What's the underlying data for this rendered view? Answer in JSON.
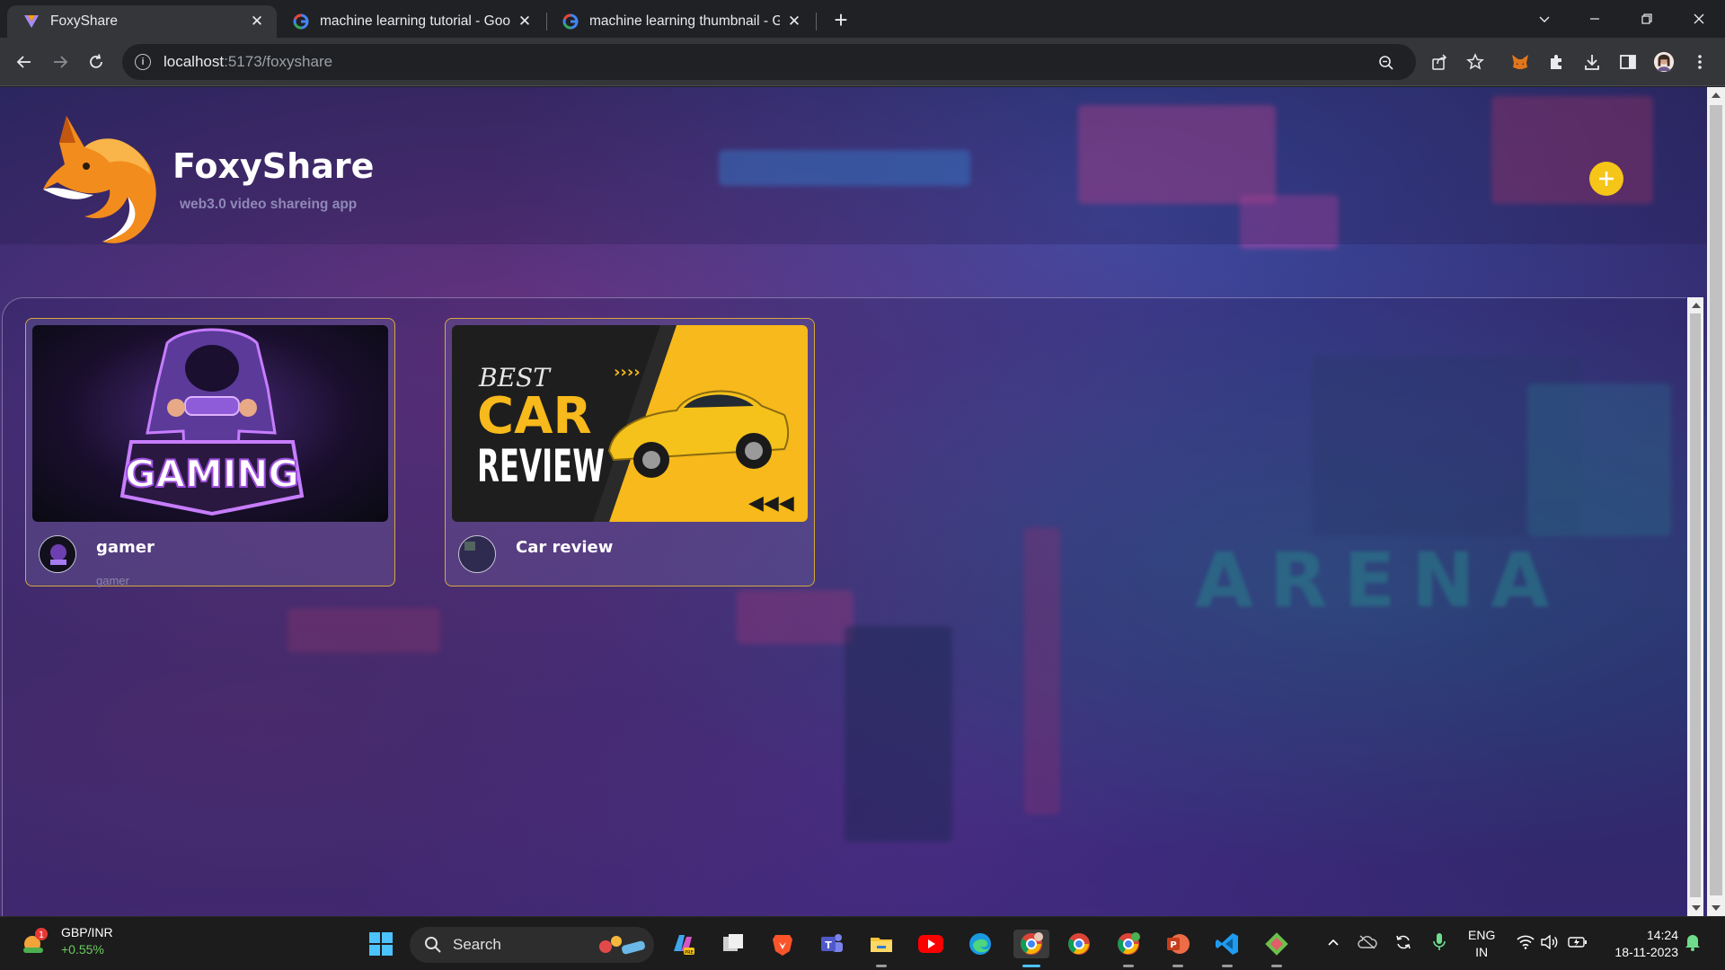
{
  "browser": {
    "tabs": [
      {
        "title": "FoxyShare",
        "active": true
      },
      {
        "title": "machine learning tutorial - Goog",
        "active": false
      },
      {
        "title": "machine learning thumbnail - Go",
        "active": false
      }
    ],
    "url_host": "localhost",
    "url_path": ":5173/foxyshare"
  },
  "app": {
    "brand": "FoxyShare",
    "tagline": "web3.0 video shareing app",
    "background_word": "ARENA",
    "cards": [
      {
        "title": "gamer",
        "subtitle": "gamer",
        "thumb_text": "GAMING"
      },
      {
        "title": "Car review",
        "subtitle": "",
        "thumb_line1": "BEST",
        "thumb_line2": "CAR",
        "thumb_line3": "REVIEW"
      }
    ],
    "accent_color": "#f5c518",
    "card_border_color": "#d4a93c"
  },
  "taskbar": {
    "ticker_pair": "GBP/INR",
    "ticker_change": "+0.55%",
    "ticker_badge": "1",
    "search_label": "Search",
    "lang_top": "ENG",
    "lang_bottom": "IN",
    "time": "14:24",
    "date": "18-11-2023"
  }
}
